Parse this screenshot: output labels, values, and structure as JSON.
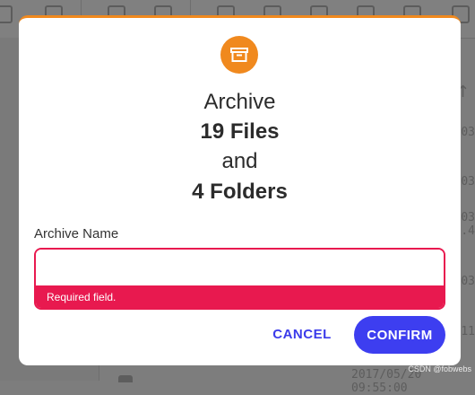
{
  "background": {
    "row_values": [
      "03",
      "03",
      "03",
      "9.4",
      "03",
      "11"
    ],
    "bottom_text": "2017/05/20 09:55:00"
  },
  "dialog": {
    "title_lines": [
      "Archive",
      "19 Files",
      "and",
      "4 Folders"
    ],
    "field_label": "Archive Name",
    "field_value": "",
    "error_text": "Required field.",
    "cancel_label": "CANCEL",
    "confirm_label": "CONFIRM",
    "accent_color": "#f0891e",
    "error_color": "#e8194f",
    "primary_color": "#3d3ef0"
  },
  "watermark": "CSDN @fobwebs"
}
